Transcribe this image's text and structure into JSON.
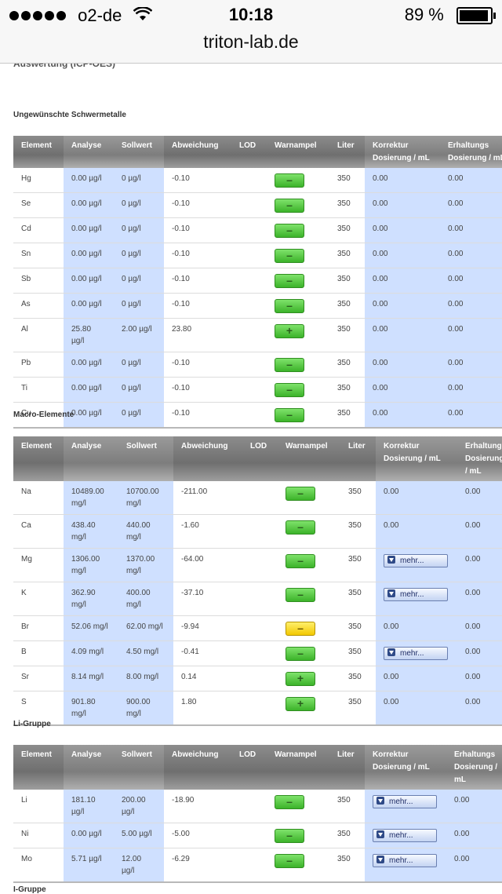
{
  "status": {
    "carrier": "o2-de",
    "time": "10:18",
    "battery": "89 %"
  },
  "url": "triton-lab.de",
  "page_title": "Auswertung (ICP-OES)",
  "headers": [
    "Element",
    "Analyse",
    "Sollwert",
    "Abweichung",
    "LOD",
    "Warnampel",
    "Liter",
    "Korrektur Dosierung / mL",
    "Erhaltungs Dosierung / mL"
  ],
  "sections": [
    {
      "title": "Ungewünschte Schwermetalle",
      "rows": [
        {
          "element": "Hg",
          "analyse": "0.00 µg/l",
          "sollwert": "0 µg/l",
          "abweichung": "-0.10",
          "lod": "",
          "ampel": "minus",
          "liter": "350",
          "korrektur": "0.00",
          "erhaltung": "0.00"
        },
        {
          "element": "Se",
          "analyse": "0.00 µg/l",
          "sollwert": "0 µg/l",
          "abweichung": "-0.10",
          "lod": "",
          "ampel": "minus",
          "liter": "350",
          "korrektur": "0.00",
          "erhaltung": "0.00"
        },
        {
          "element": "Cd",
          "analyse": "0.00 µg/l",
          "sollwert": "0 µg/l",
          "abweichung": "-0.10",
          "lod": "",
          "ampel": "minus",
          "liter": "350",
          "korrektur": "0.00",
          "erhaltung": "0.00"
        },
        {
          "element": "Sn",
          "analyse": "0.00 µg/l",
          "sollwert": "0 µg/l",
          "abweichung": "-0.10",
          "lod": "",
          "ampel": "minus",
          "liter": "350",
          "korrektur": "0.00",
          "erhaltung": "0.00"
        },
        {
          "element": "Sb",
          "analyse": "0.00 µg/l",
          "sollwert": "0 µg/l",
          "abweichung": "-0.10",
          "lod": "",
          "ampel": "minus",
          "liter": "350",
          "korrektur": "0.00",
          "erhaltung": "0.00"
        },
        {
          "element": "As",
          "analyse": "0.00 µg/l",
          "sollwert": "0 µg/l",
          "abweichung": "-0.10",
          "lod": "",
          "ampel": "minus",
          "liter": "350",
          "korrektur": "0.00",
          "erhaltung": "0.00"
        },
        {
          "element": "Al",
          "analyse": "25.80 µg/l",
          "sollwert": "2.00 µg/l",
          "abweichung": "23.80",
          "lod": "",
          "ampel": "plus",
          "liter": "350",
          "korrektur": "0.00",
          "erhaltung": "0.00"
        },
        {
          "element": "Pb",
          "analyse": "0.00 µg/l",
          "sollwert": "0 µg/l",
          "abweichung": "-0.10",
          "lod": "",
          "ampel": "minus",
          "liter": "350",
          "korrektur": "0.00",
          "erhaltung": "0.00"
        },
        {
          "element": "Ti",
          "analyse": "0.00 µg/l",
          "sollwert": "0 µg/l",
          "abweichung": "-0.10",
          "lod": "",
          "ampel": "minus",
          "liter": "350",
          "korrektur": "0.00",
          "erhaltung": "0.00"
        },
        {
          "element": "Cu",
          "analyse": "0.00 µg/l",
          "sollwert": "0 µg/l",
          "abweichung": "-0.10",
          "lod": "",
          "ampel": "minus",
          "liter": "350",
          "korrektur": "0.00",
          "erhaltung": "0.00"
        }
      ]
    },
    {
      "title": "Macro-Elemente",
      "rows": [
        {
          "element": "Na",
          "analyse": "10489.00 mg/l",
          "sollwert": "10700.00 mg/l",
          "abweichung": "-211.00",
          "lod": "",
          "ampel": "minus",
          "liter": "350",
          "korrektur": "0.00",
          "erhaltung": "0.00"
        },
        {
          "element": "Ca",
          "analyse": "438.40 mg/l",
          "sollwert": "440.00 mg/l",
          "abweichung": "-1.60",
          "lod": "",
          "ampel": "minus",
          "liter": "350",
          "korrektur": "0.00",
          "erhaltung": "0.00"
        },
        {
          "element": "Mg",
          "analyse": "1306.00 mg/l",
          "sollwert": "1370.00 mg/l",
          "abweichung": "-64.00",
          "lod": "",
          "ampel": "minus",
          "liter": "350",
          "korrektur": "mehr...",
          "erhaltung": "0.00"
        },
        {
          "element": "K",
          "analyse": "362.90 mg/l",
          "sollwert": "400.00 mg/l",
          "abweichung": "-37.10",
          "lod": "",
          "ampel": "minus",
          "liter": "350",
          "korrektur": "mehr...",
          "erhaltung": "0.00"
        },
        {
          "element": "Br",
          "analyse": "52.06 mg/l",
          "sollwert": "62.00 mg/l",
          "abweichung": "-9.94",
          "lod": "",
          "ampel": "minus-yellow",
          "liter": "350",
          "korrektur": "0.00",
          "erhaltung": "0.00"
        },
        {
          "element": "B",
          "analyse": "4.09 mg/l",
          "sollwert": "4.50 mg/l",
          "abweichung": "-0.41",
          "lod": "",
          "ampel": "minus",
          "liter": "350",
          "korrektur": "mehr...",
          "erhaltung": "0.00"
        },
        {
          "element": "Sr",
          "analyse": "8.14 mg/l",
          "sollwert": "8.00 mg/l",
          "abweichung": "0.14",
          "lod": "",
          "ampel": "plus",
          "liter": "350",
          "korrektur": "0.00",
          "erhaltung": "0.00"
        },
        {
          "element": "S",
          "analyse": "901.80 mg/l",
          "sollwert": "900.00 mg/l",
          "abweichung": "1.80",
          "lod": "",
          "ampel": "plus",
          "liter": "350",
          "korrektur": "0.00",
          "erhaltung": "0.00"
        }
      ]
    },
    {
      "title": "Li-Gruppe",
      "rows": [
        {
          "element": "Li",
          "analyse": "181.10 µg/l",
          "sollwert": "200.00 µg/l",
          "abweichung": "-18.90",
          "lod": "",
          "ampel": "minus",
          "liter": "350",
          "korrektur": "mehr...",
          "erhaltung": "0.00"
        },
        {
          "element": "Ni",
          "analyse": "0.00 µg/l",
          "sollwert": "5.00 µg/l",
          "abweichung": "-5.00",
          "lod": "",
          "ampel": "minus",
          "liter": "350",
          "korrektur": "mehr...",
          "erhaltung": "0.00"
        },
        {
          "element": "Mo",
          "analyse": "5.71 µg/l",
          "sollwert": "12.00 µg/l",
          "abweichung": "-6.29",
          "lod": "",
          "ampel": "minus",
          "liter": "350",
          "korrektur": "mehr...",
          "erhaltung": "0.00"
        }
      ]
    },
    {
      "title": "I-Gruppe",
      "rows": []
    }
  ],
  "colors": {
    "header_bg": "#7a7a7a",
    "highlight_col": "#cfe0ff",
    "ampel_green": "#4cc23a",
    "ampel_yellow": "#f6d400"
  }
}
